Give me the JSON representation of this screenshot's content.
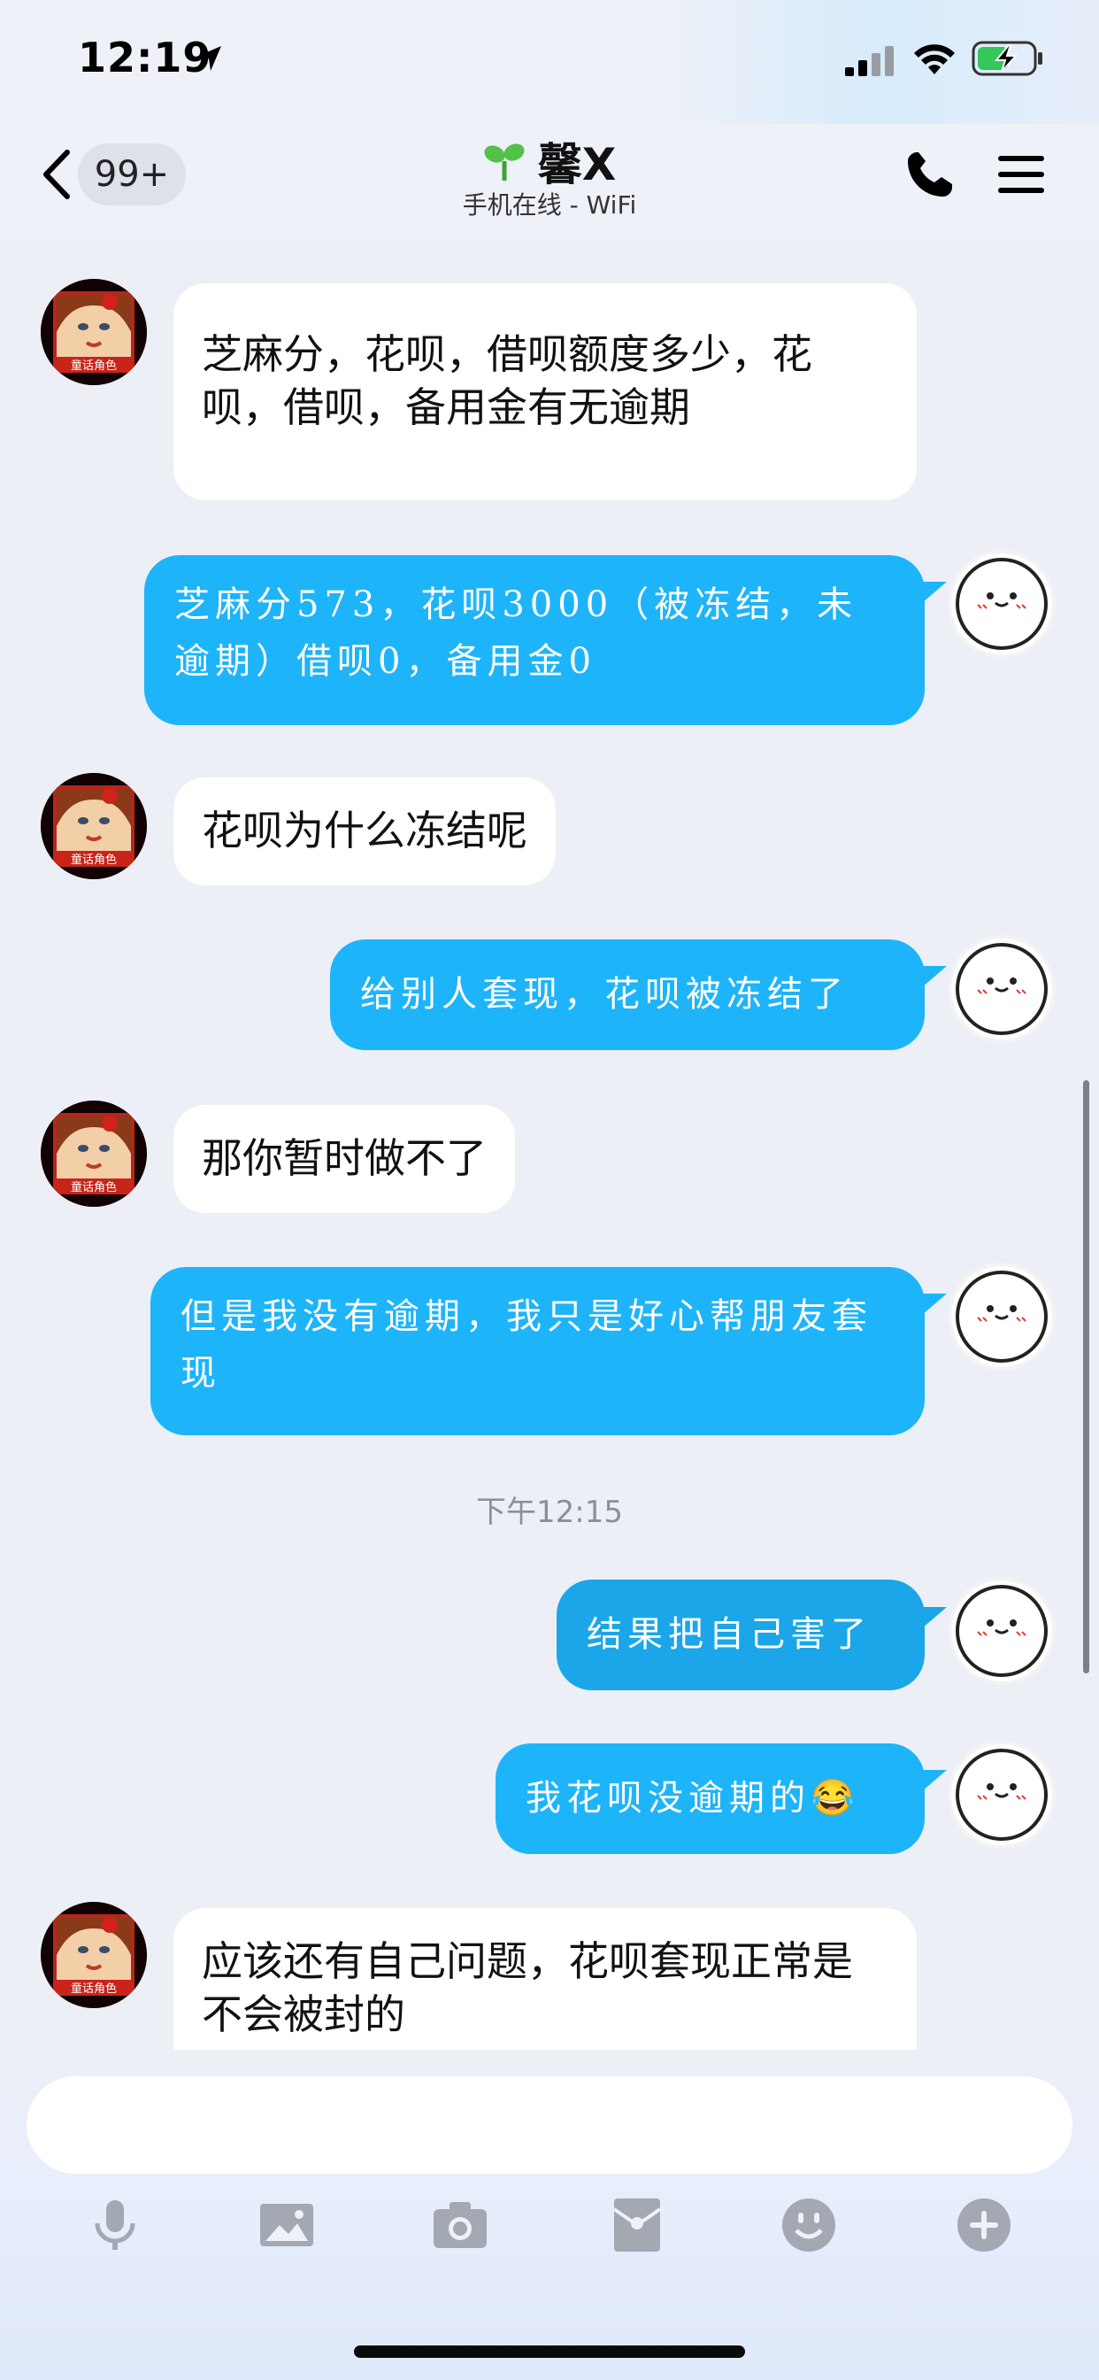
{
  "status_bar": {
    "time": "12:19",
    "location_icon": "location-arrow-icon",
    "signal_icon": "cellular-signal-icon",
    "wifi_icon": "wifi-icon",
    "battery_icon": "battery-charging-icon",
    "battery_color": "#34c759"
  },
  "nav": {
    "back_icon": "chevron-left-icon",
    "unread_count": "99+",
    "contact_icon": "sprout-icon",
    "contact_name": "馨X",
    "contact_status": "手机在线 - WiFi",
    "call_icon": "phone-icon",
    "menu_icon": "hamburger-menu-icon"
  },
  "messages": [
    {
      "side": "left",
      "text": "芝麻分，花呗，借呗额度多少，花呗，借呗，备用金有无逾期"
    },
    {
      "side": "right",
      "text": "芝麻分573，花呗3000（被冻结，未逾期）借呗0，备用金0"
    },
    {
      "side": "left",
      "text": "花呗为什么冻结呢"
    },
    {
      "side": "right",
      "text": "给别人套现，花呗被冻结了"
    },
    {
      "side": "left",
      "text": "那你暂时做不了"
    },
    {
      "side": "right",
      "text": "但是我没有逾期，我只是好心帮朋友套现"
    },
    {
      "side": "right",
      "text": "结果把自己害了"
    },
    {
      "side": "right",
      "text": "我花呗没逾期的",
      "emoji": "😂"
    },
    {
      "side": "left",
      "text": "应该还有自己问题，花呗套现正常是不会被封的"
    }
  ],
  "timestamp": "下午12:15",
  "avatar_left_caption": "童话角色",
  "bubble_colors": {
    "outgoing": "#1db4fa",
    "incoming": "#ffffff"
  },
  "composer": {
    "input_value": "",
    "toolbar": [
      "microphone-icon",
      "image-icon",
      "camera-icon",
      "red-packet-icon",
      "emoji-icon",
      "plus-icon"
    ]
  }
}
